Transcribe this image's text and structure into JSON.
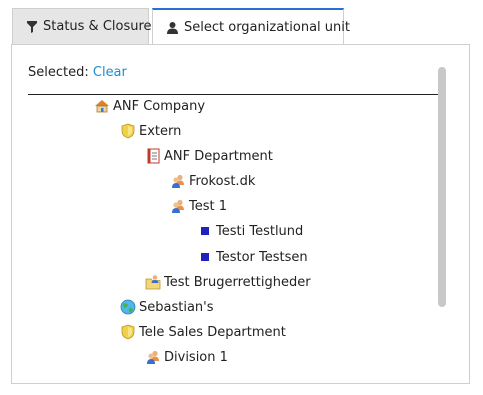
{
  "tabs": [
    {
      "label": "Status & Closure",
      "icon": "funnel-icon"
    },
    {
      "label": "Select organizational unit",
      "icon": "user-icon"
    }
  ],
  "selection": {
    "label": "Selected:",
    "clear": "Clear"
  },
  "tree": [
    {
      "label": "ANF Company",
      "icon": "home-icon",
      "level": 0
    },
    {
      "label": "Extern",
      "icon": "shield-icon",
      "level": 1
    },
    {
      "label": "ANF Department",
      "icon": "document-icon",
      "level": 2
    },
    {
      "label": "Frokost.dk",
      "icon": "users-icon",
      "level": 3
    },
    {
      "label": "Test 1",
      "icon": "users-icon",
      "level": 3
    },
    {
      "label": "Testi Testlund",
      "icon": "square-icon",
      "level": 4
    },
    {
      "label": "Testor Testsen",
      "icon": "square-icon",
      "level": 4
    },
    {
      "label": "Test Brugerrettigheder",
      "icon": "folder-user-icon",
      "level": 2
    },
    {
      "label": "Sebastian's",
      "icon": "globe-icon",
      "level": 1
    },
    {
      "label": "Tele Sales Department",
      "icon": "shield-icon",
      "level": 1
    },
    {
      "label": "Division 1",
      "icon": "users-icon",
      "level": 2
    }
  ],
  "colors": {
    "accent": "#2b6fd6",
    "link": "#1a8fd1",
    "leaf": "#2222bb"
  }
}
